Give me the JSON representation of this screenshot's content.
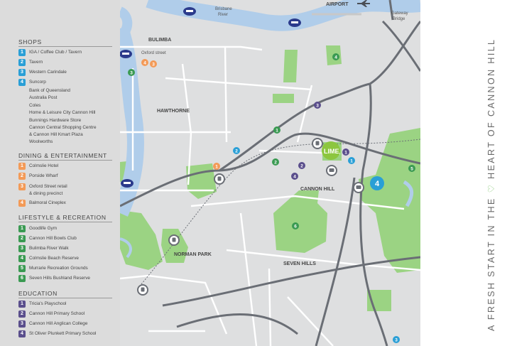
{
  "tagline": {
    "before": "A FRESH START IN THE",
    "heart": "♡",
    "after": "HEART OF  CANNON HILL"
  },
  "colors": {
    "shops": "#2a9fd6",
    "dining": "#f39a57",
    "lifestyle": "#3a9a52",
    "education": "#5a4e8c",
    "park": "#9bd383",
    "water": "#b0cdea",
    "land": "#dedfe0",
    "road": "#ffffff",
    "highway": "#6a6e75",
    "brand": "#8cc63f"
  },
  "legend": {
    "shops": {
      "title": "SHOPS",
      "items": [
        {
          "num": "1",
          "label": "IGA / Coffee Club / Tavern"
        },
        {
          "num": "2",
          "label": "Tavern"
        },
        {
          "num": "3",
          "label": "Western Carindale"
        },
        {
          "num": "4",
          "label": "Suncorp"
        }
      ],
      "subitems": [
        "Bank of Queensland",
        "Australia Post",
        "Coles",
        "Home & Leisure City Cannon Hill",
        "Bunnings Hardware Store",
        "Cannon Central Shopping Centre",
        "& Cannon Hill Kmart Plaza",
        "Woolworths"
      ]
    },
    "dining": {
      "title": "DINING & ENTERTAINMENT",
      "items": [
        {
          "num": "1",
          "label": "Colmslie Hotel"
        },
        {
          "num": "2",
          "label": "Porside Wharf"
        },
        {
          "num": "3",
          "label": "Oxford Street retail",
          "label2": "& dining precinct"
        },
        {
          "num": "4",
          "label": "Balmoral Cineplex"
        }
      ]
    },
    "lifestyle": {
      "title": "LIFESTYLE & RECREATION",
      "items": [
        {
          "num": "1",
          "label": "Goodlife Gym"
        },
        {
          "num": "2",
          "label": "Cannon Hill Bowls Club"
        },
        {
          "num": "3",
          "label": "Bulimba River Walk"
        },
        {
          "num": "4",
          "label": "Colmslie Beach Reserve"
        },
        {
          "num": "5",
          "label": "Murrarie Recreation Grounds"
        },
        {
          "num": "6",
          "label": "Seven Hills Bushland Reserve"
        }
      ]
    },
    "education": {
      "title": "EDUCATION",
      "items": [
        {
          "num": "1",
          "label": "Tricia's Playschool"
        },
        {
          "num": "2",
          "label": "Cannon Hill Primary School"
        },
        {
          "num": "3",
          "label": "Cannon Hill Anglican College"
        },
        {
          "num": "4",
          "label": "St Oliver Plunkett Primary School"
        }
      ]
    }
  },
  "map": {
    "labels": {
      "airport": "AIRPORT",
      "brisbane_river_1": "Brisbane",
      "brisbane_river_2": "River",
      "gateway_bridge_1": "Gateway",
      "gateway_bridge_2": "Bridge",
      "oxford_street": "Oxford street",
      "bulimba": "BULIMBA",
      "hawthorne": "HAWTHORNE",
      "cannon_hill": "CANNON HILL",
      "norman_park": "NORMAN PARK",
      "seven_hills": "SEVEN HILLS",
      "lime": "LIME"
    },
    "markers": {
      "shops_1": "1",
      "shops_2": "2",
      "shops_3": "3",
      "shops_4": "4",
      "dining_1": "1",
      "dining_3": "3",
      "dining_4": "4",
      "life_1": "1",
      "life_2": "2",
      "life_3": "3",
      "life_4": "4",
      "life_5": "5",
      "life_6": "6",
      "edu_1": "1",
      "edu_2": "2",
      "edu_3": "3",
      "edu_4": "4"
    }
  }
}
